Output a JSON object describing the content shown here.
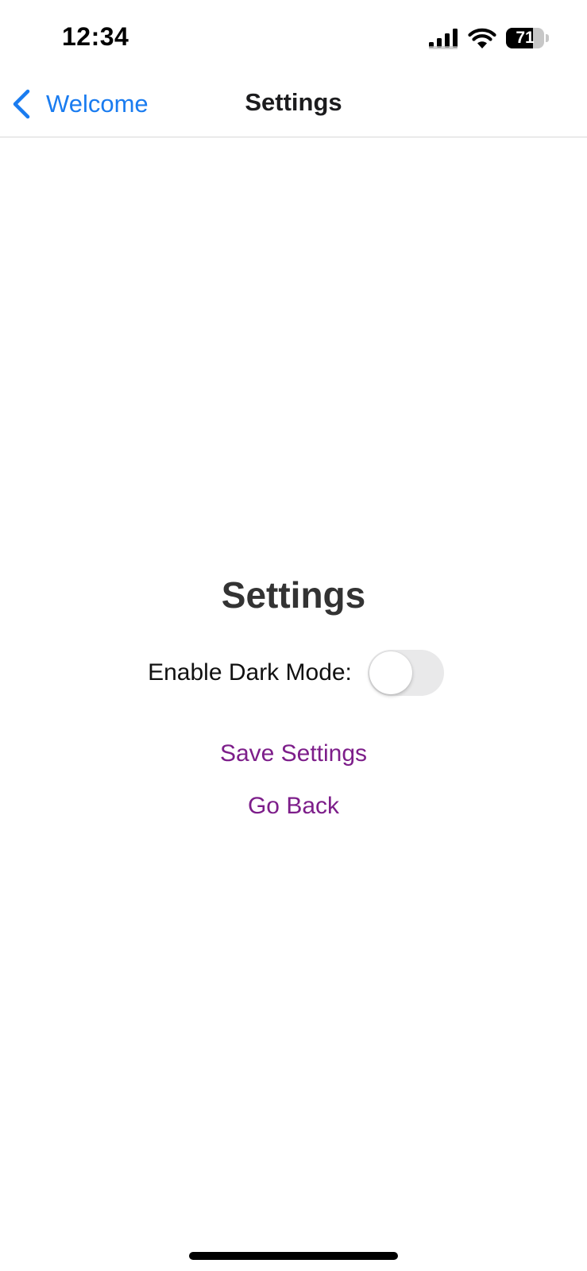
{
  "status_bar": {
    "time": "12:34",
    "battery_level": "71",
    "battery_fraction": 0.71,
    "icons": [
      "signal-icon",
      "wifi-icon",
      "battery-icon"
    ]
  },
  "nav_bar": {
    "back_label": "Welcome",
    "title": "Settings",
    "accent_color": "#1a7cf0"
  },
  "main": {
    "title": "Settings",
    "dark_mode_label": "Enable Dark Mode:",
    "dark_mode_enabled": false,
    "save_label": "Save Settings",
    "go_back_label": "Go Back",
    "link_color": "#7d1e8a"
  }
}
